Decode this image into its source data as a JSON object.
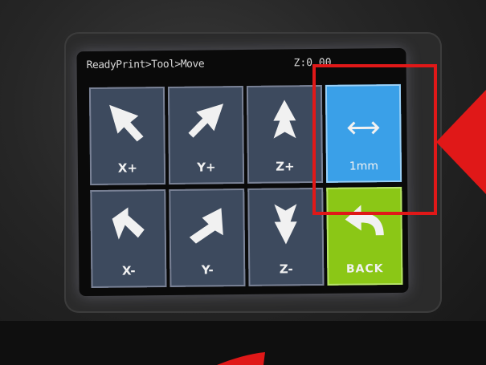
{
  "status": {
    "breadcrumb": "ReadyPrint>Tool>Move",
    "z_position": "Z:0.00"
  },
  "tiles": [
    {
      "label": "X+",
      "icon": "arrow-x-plus-icon"
    },
    {
      "label": "Y+",
      "icon": "arrow-y-plus-icon"
    },
    {
      "label": "Z+",
      "icon": "arrow-up-icon"
    },
    {
      "label": "1mm",
      "icon": "double-arrow-horizontal-icon"
    },
    {
      "label": "X-",
      "icon": "arrow-x-minus-icon"
    },
    {
      "label": "Y-",
      "icon": "arrow-y-minus-icon"
    },
    {
      "label": "Z-",
      "icon": "arrow-down-icon"
    },
    {
      "label": "BACK",
      "icon": "back-arrow-icon"
    }
  ],
  "colors": {
    "tile_bg": "#3d4a5e",
    "step_tile_bg": "#3aa0e8",
    "back_tile_bg": "#8bc716",
    "annotation_red": "#e01818"
  }
}
